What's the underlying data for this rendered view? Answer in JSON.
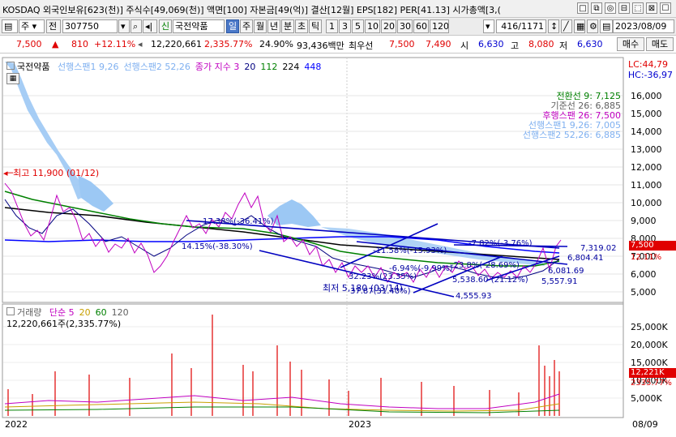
{
  "info": {
    "text": "KOSDAQ 외국인보유[623(천)] 주식수[49,069(천)] 액면[100] 자본금[49(억)] 결산[12월] EPS[182] PER[41.13] 시가총액[3,("
  },
  "window_buttons": [
    "□",
    "⧉",
    "◎",
    "⊟",
    "⬚",
    "⊠",
    "☐",
    "-"
  ],
  "toolbar": {
    "market": "주",
    "mode": "전",
    "code": "307750",
    "sin": "신",
    "stock_name": "국전약품",
    "periods": [
      "일",
      "주",
      "월",
      "년",
      "분",
      "초",
      "틱"
    ],
    "selected_period": "일",
    "intervals": [
      "1",
      "3",
      "5",
      "10",
      "20",
      "30",
      "60",
      "120"
    ],
    "page_counter": "416/1171",
    "date": "2023/08/09"
  },
  "pricebar": {
    "price": "7,500",
    "change": "810",
    "change_pct": "+12.11%",
    "volume": "12,220,661",
    "volume_pct": "2,335.77%",
    "turnover": "24.90%",
    "amount": "93,436백만",
    "priority_label": "최우선",
    "ask": "7,500",
    "bid": "7,490",
    "open_label": "시",
    "open": "6,630",
    "high_label": "고",
    "high": "8,080",
    "low_label": "저",
    "low": "6,630"
  },
  "sidebar_buttons": {
    "buy": "매수",
    "sell": "매도"
  },
  "price_chart": {
    "title": "국전약품",
    "legend_items": [
      {
        "text": "선행스팬1 9,26",
        "color": "#7fb0f0"
      },
      {
        "text": "선행스팬2 52,26",
        "color": "#7fb0f0"
      },
      {
        "text": "종가 지수 3",
        "color": "#c000c0"
      },
      {
        "text": "20",
        "color": "#000080"
      },
      {
        "text": "112",
        "color": "#008000"
      },
      {
        "text": "224",
        "color": "#000000"
      },
      {
        "text": "448",
        "color": "#0000ff"
      }
    ],
    "lc": "LC:44,79",
    "hc": "HC:-36,97",
    "indicator_labels": [
      {
        "text": "전환선 9: 7,125",
        "color": "#008000"
      },
      {
        "text": "기준선 26: 6,885",
        "color": "#606060"
      },
      {
        "text": "후행스팬 26: 7,500",
        "color": "#c000c0"
      },
      {
        "text": "선행스팬1 9,26: 7,005",
        "color": "#7fb0f0"
      },
      {
        "text": "선행스팬2 52,26: 6,885",
        "color": "#7fb0f0"
      }
    ],
    "annotations": {
      "high": "최고 11,900 (01/12)",
      "low": "최저 5,180 (03/14)",
      "lines": [
        "17.38%(-36.41%)",
        "14.15%(-38.30%)",
        "-11.58%(-15.93%)",
        "-7.82%(-3.76%)",
        "7,319.02",
        "6,804.41",
        "6,081.69",
        "5,557.91",
        "5,538.60 (21.12%)",
        "4,555.93",
        "32.23%(23.35%)",
        "37.87(31.40%)",
        "-6.94%(-9.99%)",
        "-23.8%(-28.69%)"
      ]
    },
    "y_ticks": [
      "16,000",
      "15,000",
      "14,000",
      "13,000",
      "12,000",
      "11,000",
      "10,000",
      "9,000",
      "8,000",
      "7,000",
      "6,000",
      "5,000"
    ],
    "current_price_tag": "7,500",
    "current_pct_tag": "12.11%"
  },
  "volume_chart": {
    "title": "거래량",
    "legend_items": [
      {
        "text": "단순 5",
        "color": "#c000c0"
      },
      {
        "text": "20",
        "color": "#c8a000"
      },
      {
        "text": "60",
        "color": "#008000"
      },
      {
        "text": "120",
        "color": "#606060"
      }
    ],
    "sub": "12,220,661주(2,335.77%)",
    "y_ticks": [
      "25,000K",
      "20,000K",
      "15,000K",
      "10,000K",
      "5,000K"
    ],
    "volume_tag": "12,221K",
    "volume_pct_tag": "2335.77%"
  },
  "x_axis": {
    "left": "2022",
    "middle": "2023",
    "right": "08/09"
  },
  "colors": {
    "up": "#e00000",
    "down": "#0000d0",
    "cloud": "#9cc8f4",
    "price_tag_bg": "#e00000",
    "selected": "#4a78c8"
  }
}
